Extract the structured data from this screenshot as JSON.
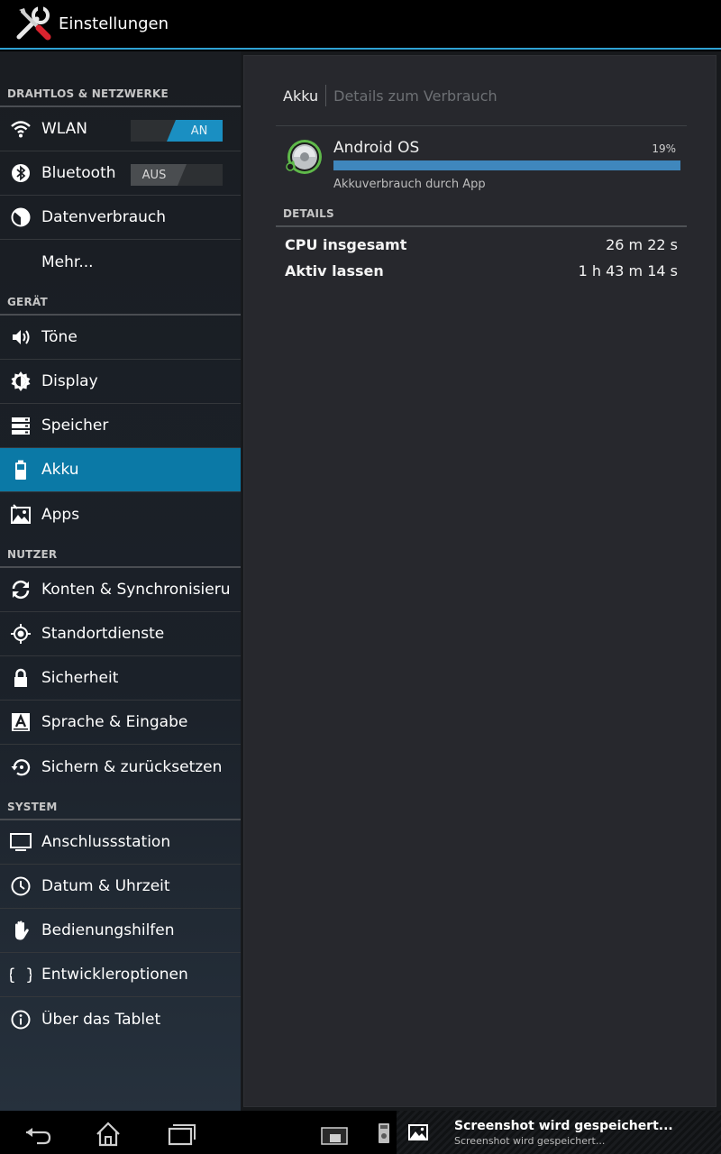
{
  "actionbar": {
    "title": "Einstellungen",
    "icon": "tools-icon"
  },
  "sidebar": {
    "sections": {
      "wireless": "DRAHTLOS & NETZWERKE",
      "device": "GERÄT",
      "user": "NUTZER",
      "system": "SYSTEM"
    },
    "items": {
      "wlan": {
        "label": "WLAN",
        "toggle": "AN"
      },
      "bluetooth": {
        "label": "Bluetooth",
        "toggle": "AUS"
      },
      "data": {
        "label": "Datenverbrauch"
      },
      "more": {
        "label": "Mehr..."
      },
      "sound": {
        "label": "Töne"
      },
      "display": {
        "label": "Display"
      },
      "storage": {
        "label": "Speicher"
      },
      "battery": {
        "label": "Akku"
      },
      "apps": {
        "label": "Apps"
      },
      "accounts": {
        "label": "Konten & Synchronisierung"
      },
      "location": {
        "label": "Standortdienste"
      },
      "security": {
        "label": "Sicherheit"
      },
      "language": {
        "label": "Sprache & Eingabe"
      },
      "backup": {
        "label": "Sichern & zurücksetzen"
      },
      "dock": {
        "label": "Anschlussstation"
      },
      "datetime": {
        "label": "Datum & Uhrzeit"
      },
      "accessibility": {
        "label": "Bedienungshilfen"
      },
      "developer": {
        "label": "Entwickleroptionen"
      },
      "about": {
        "label": "Über das Tablet"
      }
    },
    "selected": "battery"
  },
  "detail": {
    "breadcrumb_main": "Akku",
    "breadcrumb_sub": "Details zum Verbrauch",
    "app": {
      "name": "Android OS",
      "percent_label": "19%",
      "usage_fraction": 1.0,
      "subtitle": "Akkuverbrauch durch App"
    },
    "details_header": "DETAILS",
    "rows": [
      {
        "label": "CPU insgesamt",
        "value": "26 m 22 s"
      },
      {
        "label": "Aktiv lassen",
        "value": "1 h 43 m 14 s"
      }
    ]
  },
  "systembar": {
    "notification_title": "Screenshot wird gespeichert...",
    "notification_text": "Screenshot wird gespeichert..."
  },
  "colors": {
    "accent": "#2fa2d4",
    "selected": "#0b79a6",
    "toggle_on": "#1a8fc2",
    "bar": "#3f87bd"
  }
}
